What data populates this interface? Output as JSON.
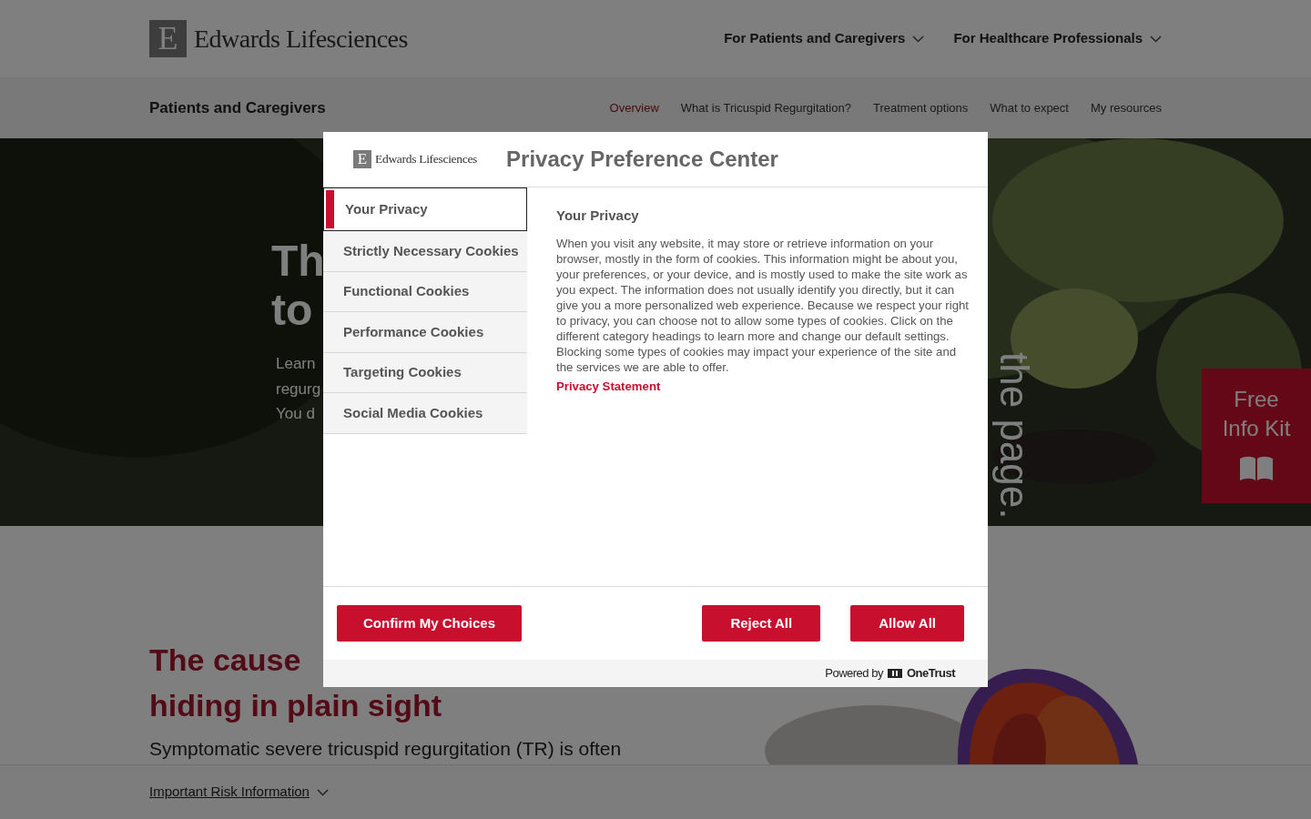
{
  "header": {
    "logo_mark": "E",
    "logo": "Edwards Lifesciences",
    "nav": [
      {
        "label": "For Patients and Caregivers"
      },
      {
        "label": "For Healthcare Professionals"
      }
    ]
  },
  "subnav": {
    "title": "Patients and Caregivers",
    "links": [
      {
        "label": "Overview",
        "selected": true
      },
      {
        "label": "What is Tricuspid Regurgitation?",
        "selected": false
      },
      {
        "label": "Treatment options",
        "selected": false
      },
      {
        "label": "What to expect",
        "selected": false
      },
      {
        "label": "My resources",
        "selected": false
      }
    ]
  },
  "hero": {
    "headline": [
      "Th",
      "to"
    ],
    "body": [
      "Learn",
      "regurg",
      "You d"
    ],
    "vertical_caption": "the page."
  },
  "info_kit": {
    "label": "Free Info Kit"
  },
  "content": {
    "heading": [
      "The cause",
      "hiding in plain sight"
    ],
    "paragraph": "Symptomatic severe tricuspid regurgitation (TR) is often"
  },
  "risk_bar": {
    "label": "Important Risk Information"
  },
  "modal": {
    "logo_mark": "E",
    "logo": "Edwards Lifesciences",
    "title": "Privacy Preference Center",
    "categories": [
      {
        "label": "Your Privacy",
        "selected": true
      },
      {
        "label": "Strictly Necessary Cookies",
        "selected": false
      },
      {
        "label": "Functional Cookies",
        "selected": false
      },
      {
        "label": "Performance Cookies",
        "selected": false
      },
      {
        "label": "Targeting Cookies",
        "selected": false
      },
      {
        "label": "Social Media Cookies",
        "selected": false
      }
    ],
    "section_title": "Your Privacy",
    "description": "When you visit any website, it may store or retrieve information on your browser, mostly in the form of cookies. This information might be about you, your preferences, or your device, and is mostly used to make the site work as you expect. The information does not usually identify you directly, but it can give you a more personalized web experience. Because we respect your right to privacy, you can choose not to allow some types of cookies. Click on the different category headings to learn more and change our default settings. Blocking some types of cookies may impact your experience of the site and the services we are able to offer.",
    "link": "Privacy Statement",
    "buttons": [
      {
        "label": "Confirm My Choices",
        "kind": "left"
      },
      {
        "label": "Reject All",
        "kind": "right"
      },
      {
        "label": "Allow All",
        "kind": "right"
      }
    ],
    "powered_by": "Powered by",
    "brand": "OneTrust"
  }
}
